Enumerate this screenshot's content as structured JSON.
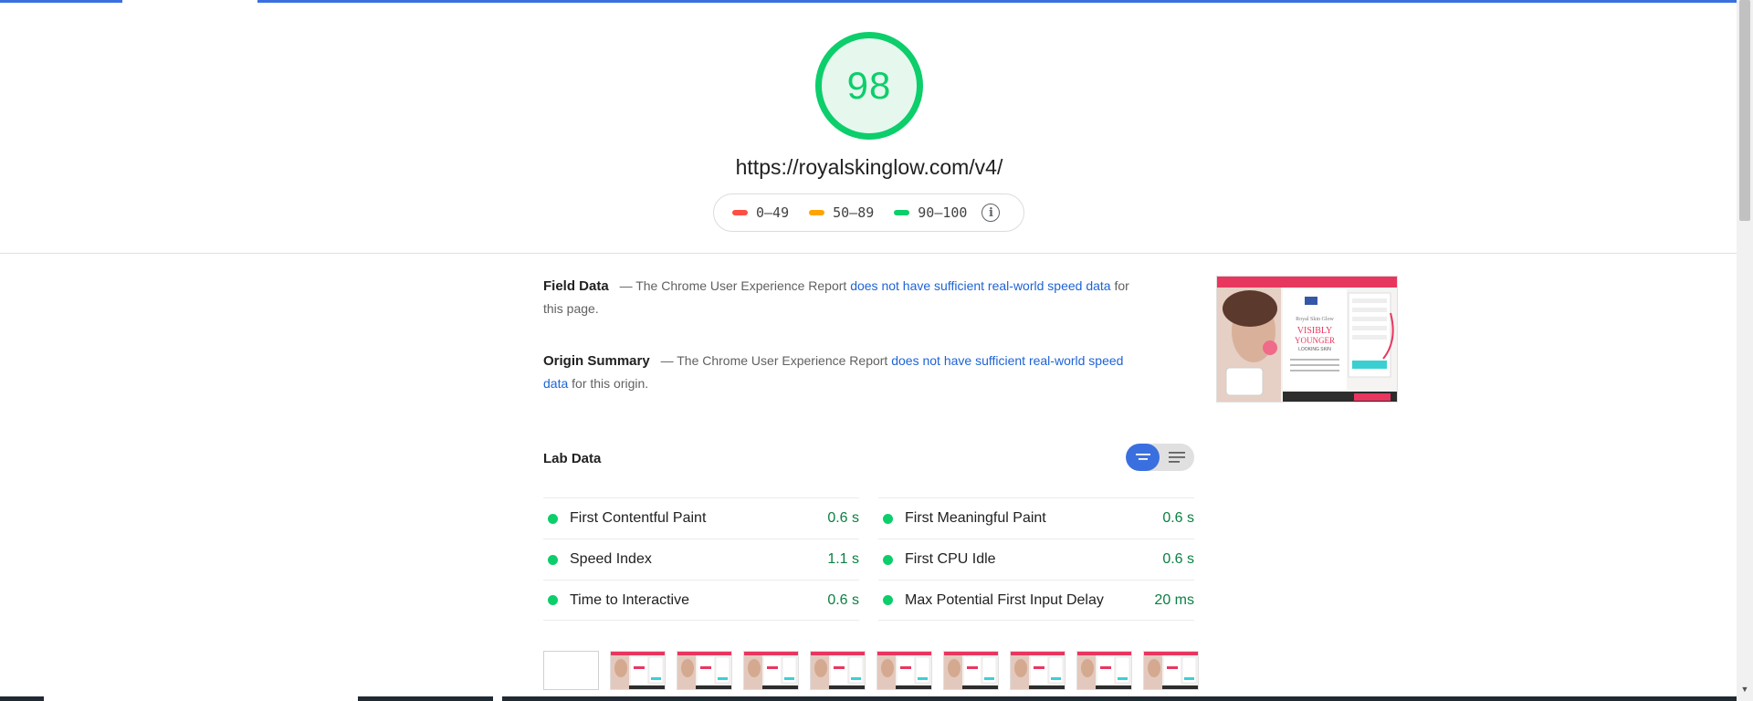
{
  "colors": {
    "pass": "#0cce6b",
    "average": "#ffa400",
    "fail": "#ff4e42",
    "link": "#1e63d6",
    "metric_value": "#0b8043",
    "accent": "#3a6fe0"
  },
  "header": {
    "score": "98",
    "url": "https://royalskinglow.com/v4/",
    "legend": [
      {
        "label": "0–49",
        "color": "#ff4e42"
      },
      {
        "label": "50–89",
        "color": "#ffa400"
      },
      {
        "label": "90–100",
        "color": "#0cce6b"
      }
    ],
    "info_icon": "info-icon"
  },
  "field_data": {
    "title": "Field Data",
    "prefix": "— The Chrome User Experience Report",
    "link": "does not have sufficient real-world speed data",
    "suffix": "for this page."
  },
  "origin_summary": {
    "title": "Origin Summary",
    "prefix": "— The Chrome User Experience Report",
    "link": "does not have sufficient real-world speed data",
    "suffix": "for this origin."
  },
  "lab_data": {
    "title": "Lab Data",
    "metrics_left": [
      {
        "name": "First Contentful Paint",
        "value": "0.6 s"
      },
      {
        "name": "Speed Index",
        "value": "1.1 s"
      },
      {
        "name": "Time to Interactive",
        "value": "0.6 s"
      }
    ],
    "metrics_right": [
      {
        "name": "First Meaningful Paint",
        "value": "0.6 s"
      },
      {
        "name": "First CPU Idle",
        "value": "0.6 s"
      },
      {
        "name": "Max Potential First Input Delay",
        "value": "20 ms"
      }
    ]
  },
  "screenshot_thumb": {
    "brand": "Royal Skin Glow",
    "headline": "VISIBLY YOUNGER",
    "sub": "LOOKING SKIN"
  },
  "filmstrip_frames": 10
}
